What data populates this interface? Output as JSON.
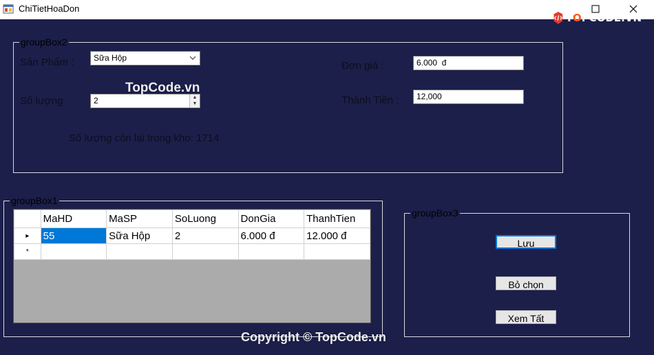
{
  "window": {
    "title": "ChiTietHoaDon",
    "logo_text_a": "T",
    "logo_text_o": "O",
    "logo_text_b": "PCODE.VN"
  },
  "groupbox2": {
    "title": "groupBox2",
    "san_pham_label": "Sản Phẩm :",
    "san_pham_value": "Sữa Hộp",
    "so_luong_label": "Số lượng",
    "so_luong_value": "2",
    "don_gia_label": "Đơn giá :",
    "don_gia_value": "6.000  đ",
    "thanh_tien_label": "Thành Tiền :",
    "thanh_tien_value": "12,000",
    "ton_kho_text": "Số lượng còn lại trong kho: 1714"
  },
  "groupbox1": {
    "title": "groupBox1",
    "columns": [
      "MaHD",
      "MaSP",
      "SoLuong",
      "DonGia",
      "ThanhTien"
    ],
    "rows": [
      [
        "55",
        "Sữa Hộp",
        "2",
        "6.000 đ",
        "12.000 đ"
      ]
    ],
    "current_row_marker": "▸",
    "new_row_marker": "*"
  },
  "groupbox3": {
    "title": "groupBox3",
    "luu_label": "Lưu",
    "bo_chon_label": "Bỏ chọn",
    "xem_tat_label": "Xem Tất"
  },
  "watermarks": {
    "center": "TopCode.vn",
    "bottom": "Copyright © TopCode.vn"
  }
}
